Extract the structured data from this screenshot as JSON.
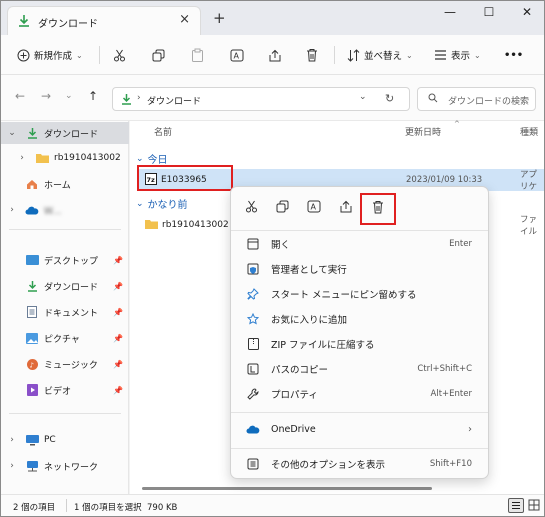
{
  "window": {
    "tab_title": "ダウンロード",
    "new_tab": "+",
    "close_tab": "×",
    "minimize": "—",
    "maximize": "☐",
    "close": "✕"
  },
  "toolbar": {
    "new_label": "新規作成",
    "sort_label": "並べ替え",
    "view_label": "表示",
    "more_label": "•••"
  },
  "address": {
    "path": "ダウンロード",
    "search_placeholder": "ダウンロードの検索"
  },
  "sidebar": {
    "items": [
      {
        "label": "ダウンロード",
        "icon": "download-icon"
      },
      {
        "label": "rb1910413002",
        "icon": "folder-icon"
      },
      {
        "label": "ホーム",
        "icon": "home-icon"
      },
      {
        "label": "Ｗ...",
        "icon": "cloud-icon"
      },
      {
        "label": "デスクトップ",
        "icon": "desktop-icon"
      },
      {
        "label": "ダウンロード",
        "icon": "download-icon"
      },
      {
        "label": "ドキュメント",
        "icon": "document-icon"
      },
      {
        "label": "ピクチャ",
        "icon": "picture-icon"
      },
      {
        "label": "ミュージック",
        "icon": "music-icon"
      },
      {
        "label": "ビデオ",
        "icon": "video-icon"
      },
      {
        "label": "PC",
        "icon": "pc-icon"
      },
      {
        "label": "ネットワーク",
        "icon": "network-icon"
      }
    ]
  },
  "content": {
    "columns": {
      "name": "名前",
      "date": "更新日時",
      "type": "種類"
    },
    "groups": [
      {
        "label": "今日"
      },
      {
        "label": "かなり前"
      }
    ],
    "files": [
      {
        "name": "E1033965",
        "date": "2023/01/09 10:33",
        "type": "アプリケ"
      },
      {
        "name": "rb1910413002",
        "date": "",
        "type": "ファイル"
      }
    ]
  },
  "context_menu": {
    "items": [
      {
        "label": "開く",
        "shortcut": "Enter",
        "icon": "open-icon"
      },
      {
        "label": "管理者として実行",
        "shortcut": "",
        "icon": "shield-icon"
      },
      {
        "label": "スタート メニューにピン留めする",
        "shortcut": "",
        "icon": "pin-icon"
      },
      {
        "label": "お気に入りに追加",
        "shortcut": "",
        "icon": "star-icon"
      },
      {
        "label": "ZIP ファイルに圧縮する",
        "shortcut": "",
        "icon": "zip-icon"
      },
      {
        "label": "パスのコピー",
        "shortcut": "Ctrl+Shift+C",
        "icon": "path-copy-icon"
      },
      {
        "label": "プロパティ",
        "shortcut": "Alt+Enter",
        "icon": "wrench-icon"
      },
      {
        "label": "OneDrive",
        "shortcut": "",
        "icon": "onedrive-icon"
      },
      {
        "label": "その他のオプションを表示",
        "shortcut": "Shift+F10",
        "icon": "more-options-icon"
      }
    ]
  },
  "status": {
    "count": "2 個の項目",
    "selected": "1 個の項目を選択  790 KB"
  },
  "colors": {
    "accent": "#0f6cbd",
    "download_green": "#2e9e4f",
    "folder": "#f2c14e",
    "highlight": "#e02020"
  }
}
